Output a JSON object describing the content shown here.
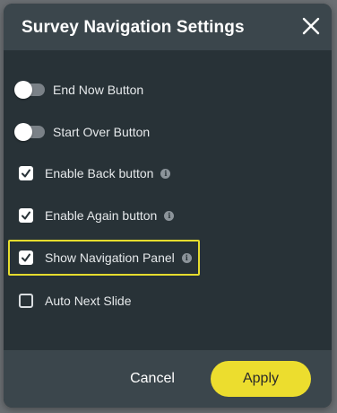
{
  "dialog": {
    "title": "Survey Navigation Settings",
    "close_icon": "close-icon"
  },
  "options": [
    {
      "type": "toggle",
      "label": "End Now Button",
      "on": false,
      "info": false
    },
    {
      "type": "toggle",
      "label": "Start Over Button",
      "on": false,
      "info": false
    },
    {
      "type": "checkbox",
      "label": "Enable Back button",
      "checked": true,
      "info": true
    },
    {
      "type": "checkbox",
      "label": "Enable Again button",
      "checked": true,
      "info": true
    },
    {
      "type": "checkbox",
      "label": "Show Navigation Panel",
      "checked": true,
      "info": true,
      "highlighted": true
    },
    {
      "type": "checkbox",
      "label": "Auto Next Slide",
      "checked": false,
      "info": false
    }
  ],
  "info_glyph": "i",
  "footer": {
    "cancel_label": "Cancel",
    "apply_label": "Apply"
  },
  "colors": {
    "dialog_bg": "#283237",
    "header_bg": "#3b464c",
    "accent": "#ecdd2e",
    "highlight": "#e6dc2e"
  }
}
